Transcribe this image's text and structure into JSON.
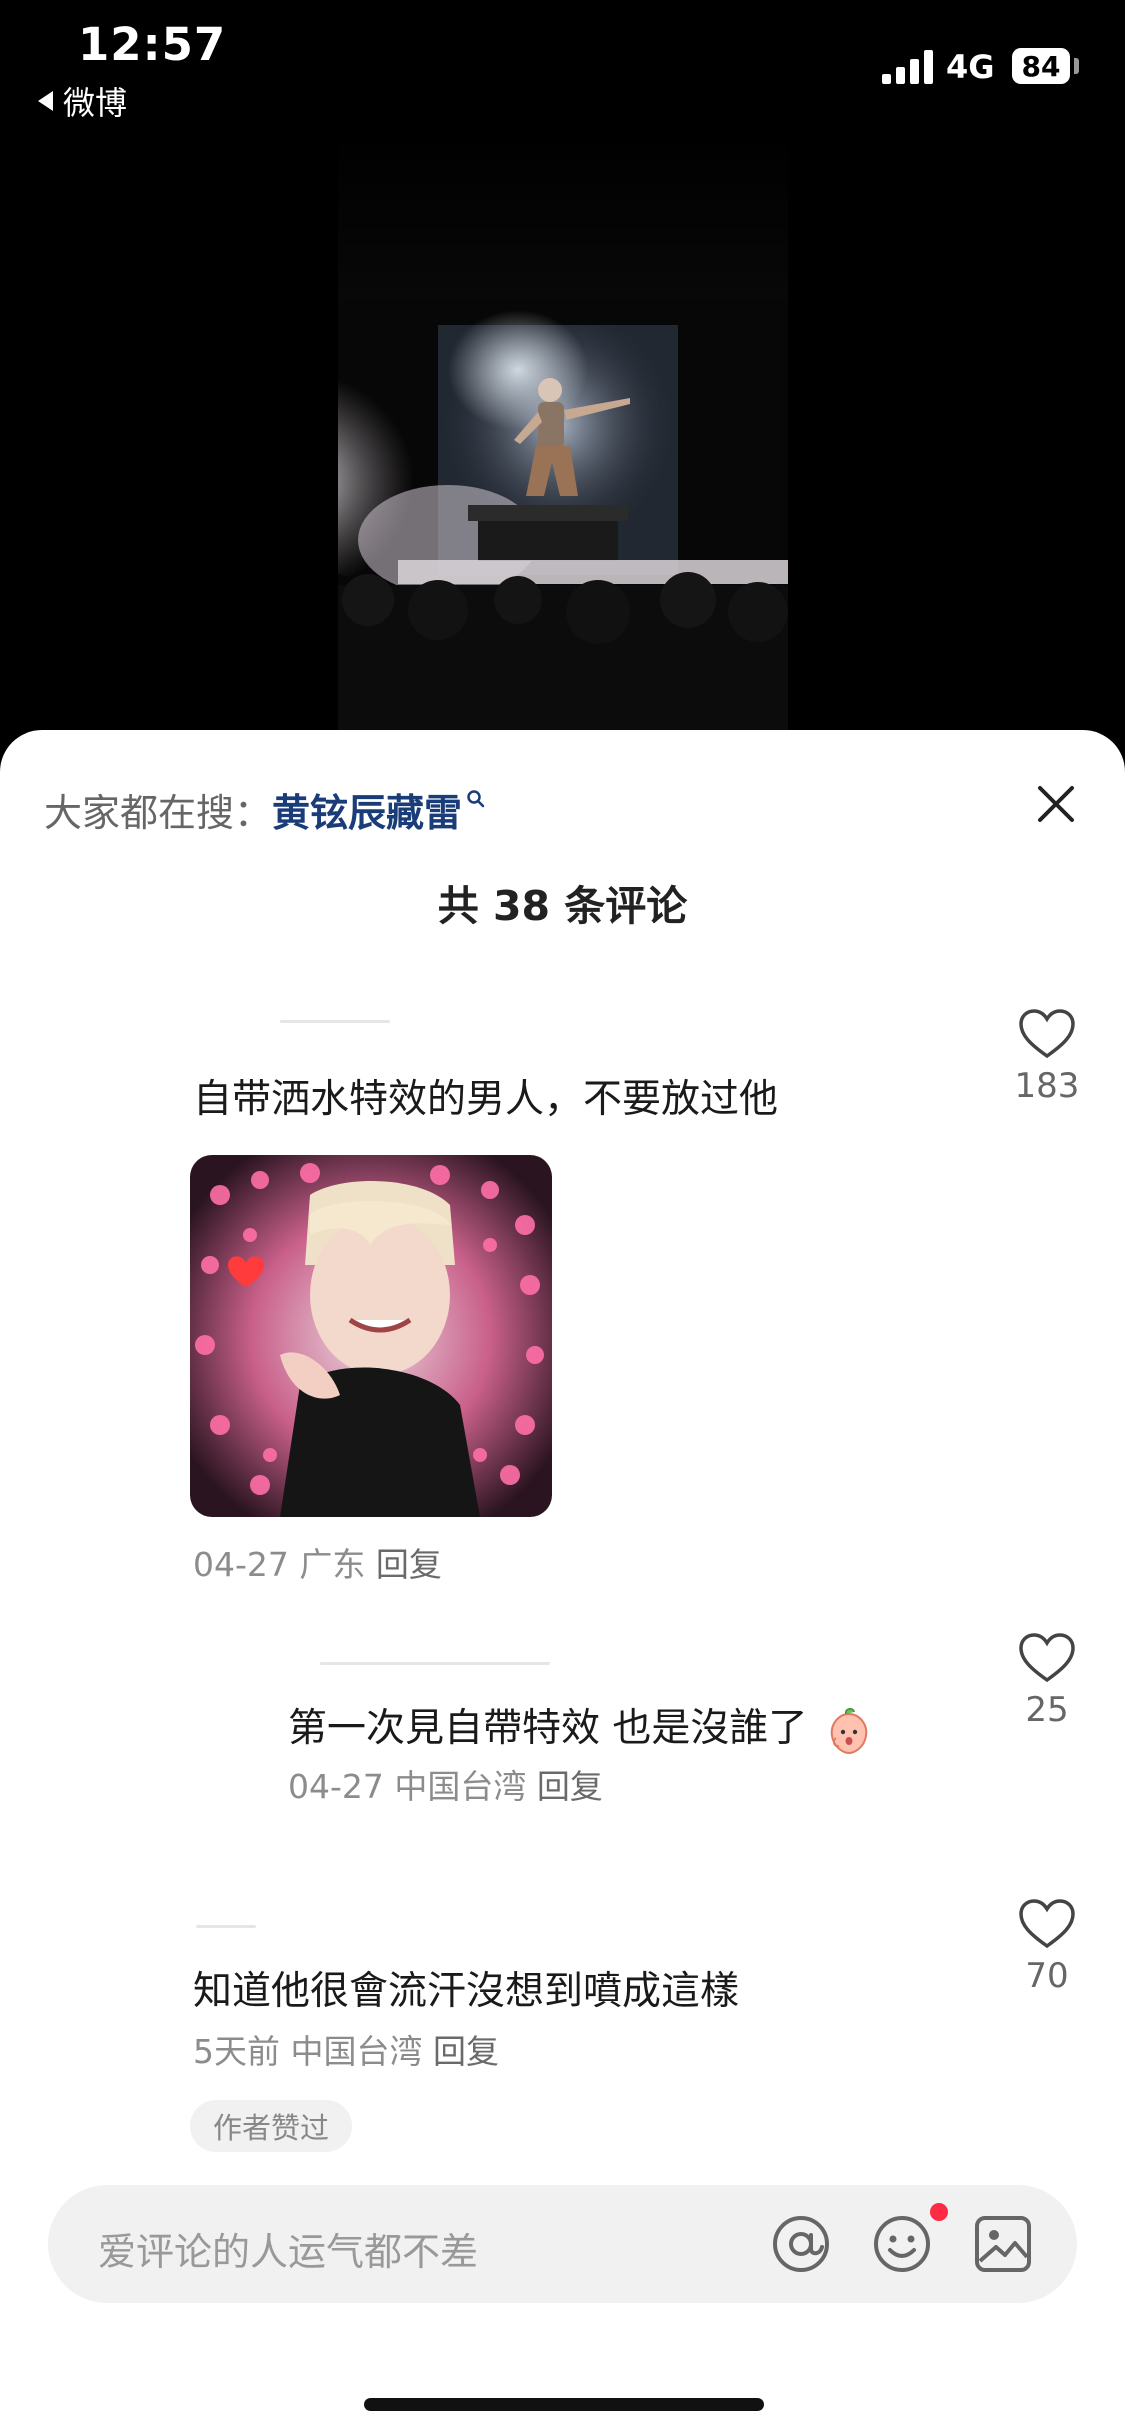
{
  "status_bar": {
    "time": "12:57",
    "back_label": "微博",
    "network": "4G",
    "battery": "84"
  },
  "sheet": {
    "search_prefix": "大家都在搜：",
    "search_term": "黄铉辰藏雷",
    "comment_count": "共 38 条评论"
  },
  "comments": [
    {
      "text": "自带洒水特效的男人，不要放过他",
      "meta_date": "04-27",
      "meta_location": "广东",
      "reply_label": "回复",
      "likes": "183",
      "has_image": true
    },
    {
      "text": "第一次見自帶特效 也是沒誰了",
      "meta_date": "04-27",
      "meta_location": "中国台湾",
      "reply_label": "回复",
      "likes": "25",
      "emoji": "peach-face-emoji"
    },
    {
      "text": "知道他很會流汗沒想到噴成這樣",
      "meta_date": "5天前",
      "meta_location": "中国台湾",
      "reply_label": "回复",
      "likes": "70",
      "badge": "作者赞过"
    }
  ],
  "input": {
    "placeholder": "爱评论的人运气都不差"
  },
  "colors": {
    "accent_link": "#1a3c78",
    "notification_dot": "#ff2a43",
    "sheet_bg": "#ffffff"
  }
}
